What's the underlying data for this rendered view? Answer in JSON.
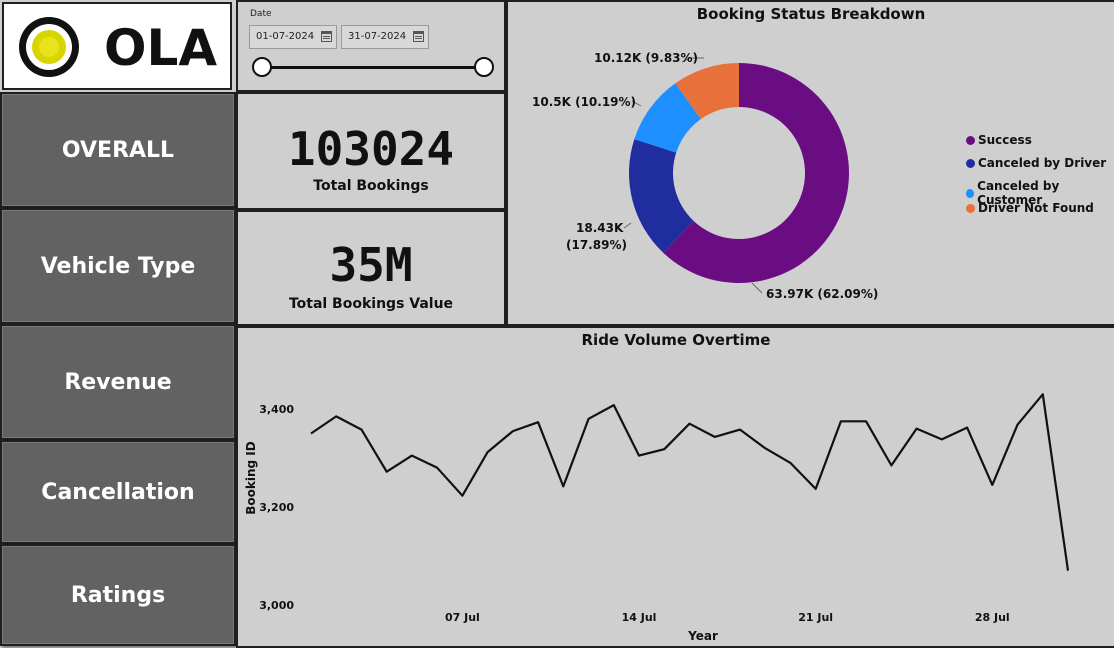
{
  "brand": {
    "name": "OLA"
  },
  "nav": [
    {
      "label": "OVERALL"
    },
    {
      "label": "Vehicle Type"
    },
    {
      "label": "Revenue"
    },
    {
      "label": "Cancellation"
    },
    {
      "label": "Ratings"
    }
  ],
  "date_filter": {
    "label": "Date",
    "start": "01-07-2024",
    "end": "31-07-2024",
    "calendar_icon": "calendar-icon"
  },
  "kpis": {
    "total_bookings": {
      "value": "103024",
      "label": "Total Bookings"
    },
    "total_value": {
      "value": "35M",
      "label": "Total Bookings Value"
    }
  },
  "colors": {
    "success": "#6a0d83",
    "canceled_by_driver": "#1f2d9e",
    "canceled_by_customer": "#1e8fff",
    "driver_not_found": "#e8703a",
    "nav_bg": "#626262",
    "page_bg": "#cfcfcf"
  },
  "chart_data": [
    {
      "type": "pie",
      "title": "Booking Status Breakdown",
      "legend_position": "right",
      "slices": [
        {
          "name": "Success",
          "value": 63.97,
          "label": "63.97K (62.09%)",
          "color": "#6a0d83"
        },
        {
          "name": "Canceled by Driver",
          "value": 18.43,
          "label": "18.43K (17.89%)",
          "label_line1": "18.43K",
          "label_line2": "(17.89%)",
          "color": "#1f2d9e"
        },
        {
          "name": "Canceled by Customer",
          "value": 10.5,
          "label": "10.5K (10.19%)",
          "color": "#1e8fff"
        },
        {
          "name": "Driver Not Found",
          "value": 10.12,
          "label": "10.12K (9.83%)",
          "color": "#e8703a"
        }
      ]
    },
    {
      "type": "line",
      "title": "Ride Volume Overtime",
      "xlabel": "Year",
      "ylabel": "Booking ID",
      "x": [
        1,
        2,
        3,
        4,
        5,
        6,
        7,
        8,
        9,
        10,
        11,
        12,
        13,
        14,
        15,
        16,
        17,
        18,
        19,
        20,
        21,
        22,
        23,
        24,
        25,
        26,
        27,
        28,
        29,
        30,
        31
      ],
      "xticks": [
        {
          "x": 7,
          "label": "07 Jul"
        },
        {
          "x": 14,
          "label": "14 Jul"
        },
        {
          "x": 21,
          "label": "21 Jul"
        },
        {
          "x": 28,
          "label": "28 Jul"
        }
      ],
      "yticks": [
        {
          "y": 3000,
          "label": "3,000"
        },
        {
          "y": 3200,
          "label": "3,200"
        },
        {
          "y": 3400,
          "label": "3,400"
        }
      ],
      "ylim": [
        3000,
        3450
      ],
      "values": [
        3350,
        3385,
        3358,
        3272,
        3305,
        3280,
        3223,
        3312,
        3355,
        3373,
        3242,
        3380,
        3408,
        3305,
        3318,
        3370,
        3343,
        3358,
        3320,
        3290,
        3237,
        3375,
        3375,
        3285,
        3360,
        3338,
        3362,
        3245,
        3368,
        3430,
        3070
      ],
      "grid": false
    }
  ]
}
